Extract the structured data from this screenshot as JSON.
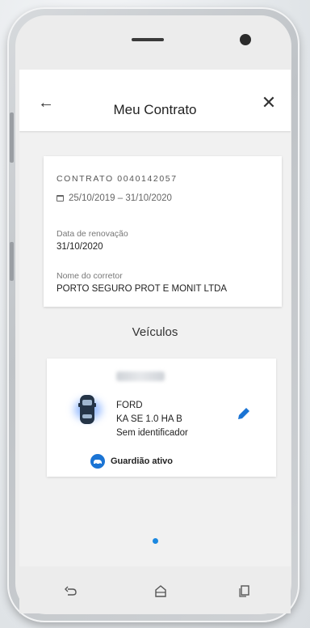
{
  "appbar": {
    "title": "Meu Contrato"
  },
  "contract": {
    "number_label": "CONTRATO 0040142057",
    "period": "25/10/2019 – 31/10/2020",
    "renewal_label": "Data de renovação",
    "renewal_date": "31/10/2020",
    "broker_label": "Nome do corretor",
    "broker_name": "PORTO SEGURO PROT E MONIT LTDA"
  },
  "vehicles": {
    "section_title": "Veículos",
    "items": [
      {
        "brand": "FORD",
        "model": "KA SE 1.0 HA B",
        "identifier": "Sem identificador",
        "guardian_status": "Guardião ativo"
      }
    ]
  },
  "colors": {
    "accent": "#1b74d4",
    "page_dot": "#1b88e0",
    "screen_bg": "#f1f1f1"
  },
  "icons": {
    "back": "arrow-left-icon",
    "close": "close-icon",
    "calendar": "calendar-icon",
    "car": "car-icon",
    "edit": "pencil-icon",
    "guardian": "guardian-icon",
    "nav_back": "nav-back-icon",
    "nav_home": "nav-home-icon",
    "nav_recent": "nav-recent-icon"
  },
  "pager": {
    "total": 1,
    "active": 1
  }
}
